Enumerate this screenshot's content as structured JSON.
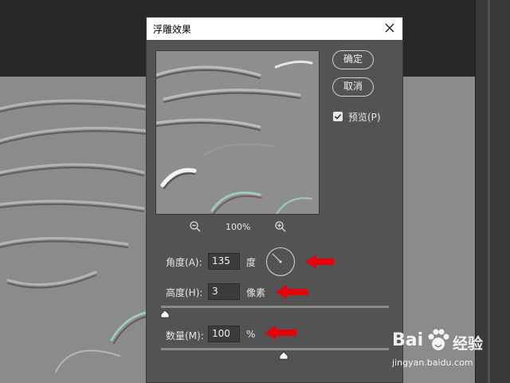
{
  "dialog": {
    "title": "浮雕效果",
    "ok_label": "确定",
    "cancel_label": "取消",
    "preview_label": "预览(P)",
    "preview_checked": true,
    "zoom_level": "100%",
    "angle_label": "角度(A):",
    "angle_value": "135",
    "angle_unit": "度",
    "height_label": "高度(H):",
    "height_value": "3",
    "height_unit": "像素",
    "amount_label": "数量(M):",
    "amount_value": "100",
    "amount_unit": "%",
    "height_slider_fraction": 0.0,
    "amount_slider_fraction": 0.54
  },
  "watermark": {
    "brand": "Bai",
    "brand_suffix": "经验",
    "url": "jingyan.baidu.com"
  },
  "colors": {
    "dialog_bg": "#535353",
    "arrow": "#e8000b",
    "canvas_gray": "#8b8b8b"
  }
}
